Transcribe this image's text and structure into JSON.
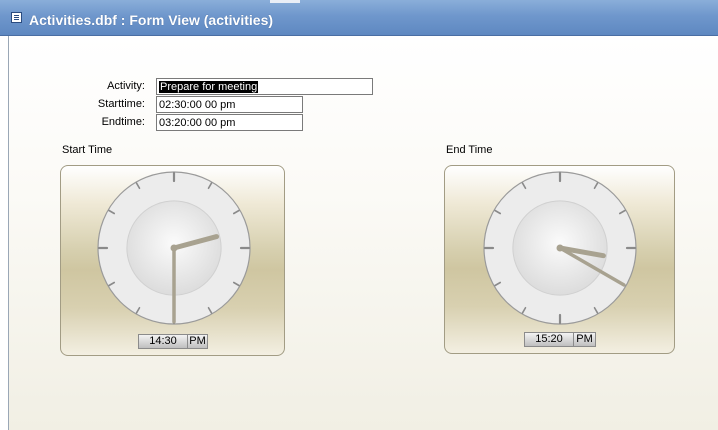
{
  "window": {
    "title": "Activities.dbf : Form View (activities)",
    "icon": "form-icon"
  },
  "form": {
    "activity": {
      "label": "Activity:",
      "value": "Prepare for meeting"
    },
    "starttime": {
      "label": "Starttime:",
      "value": "02:30:00 00 pm"
    },
    "endtime": {
      "label": "Endtime:",
      "value": "03:20:00 00 pm"
    }
  },
  "start_clock": {
    "label": "Start Time",
    "time": "14:30",
    "ampm": "PM",
    "hour": 14,
    "minute": 30
  },
  "end_clock": {
    "label": "End Time",
    "time": "15:20",
    "ampm": "PM",
    "hour": 15,
    "minute": 20
  }
}
